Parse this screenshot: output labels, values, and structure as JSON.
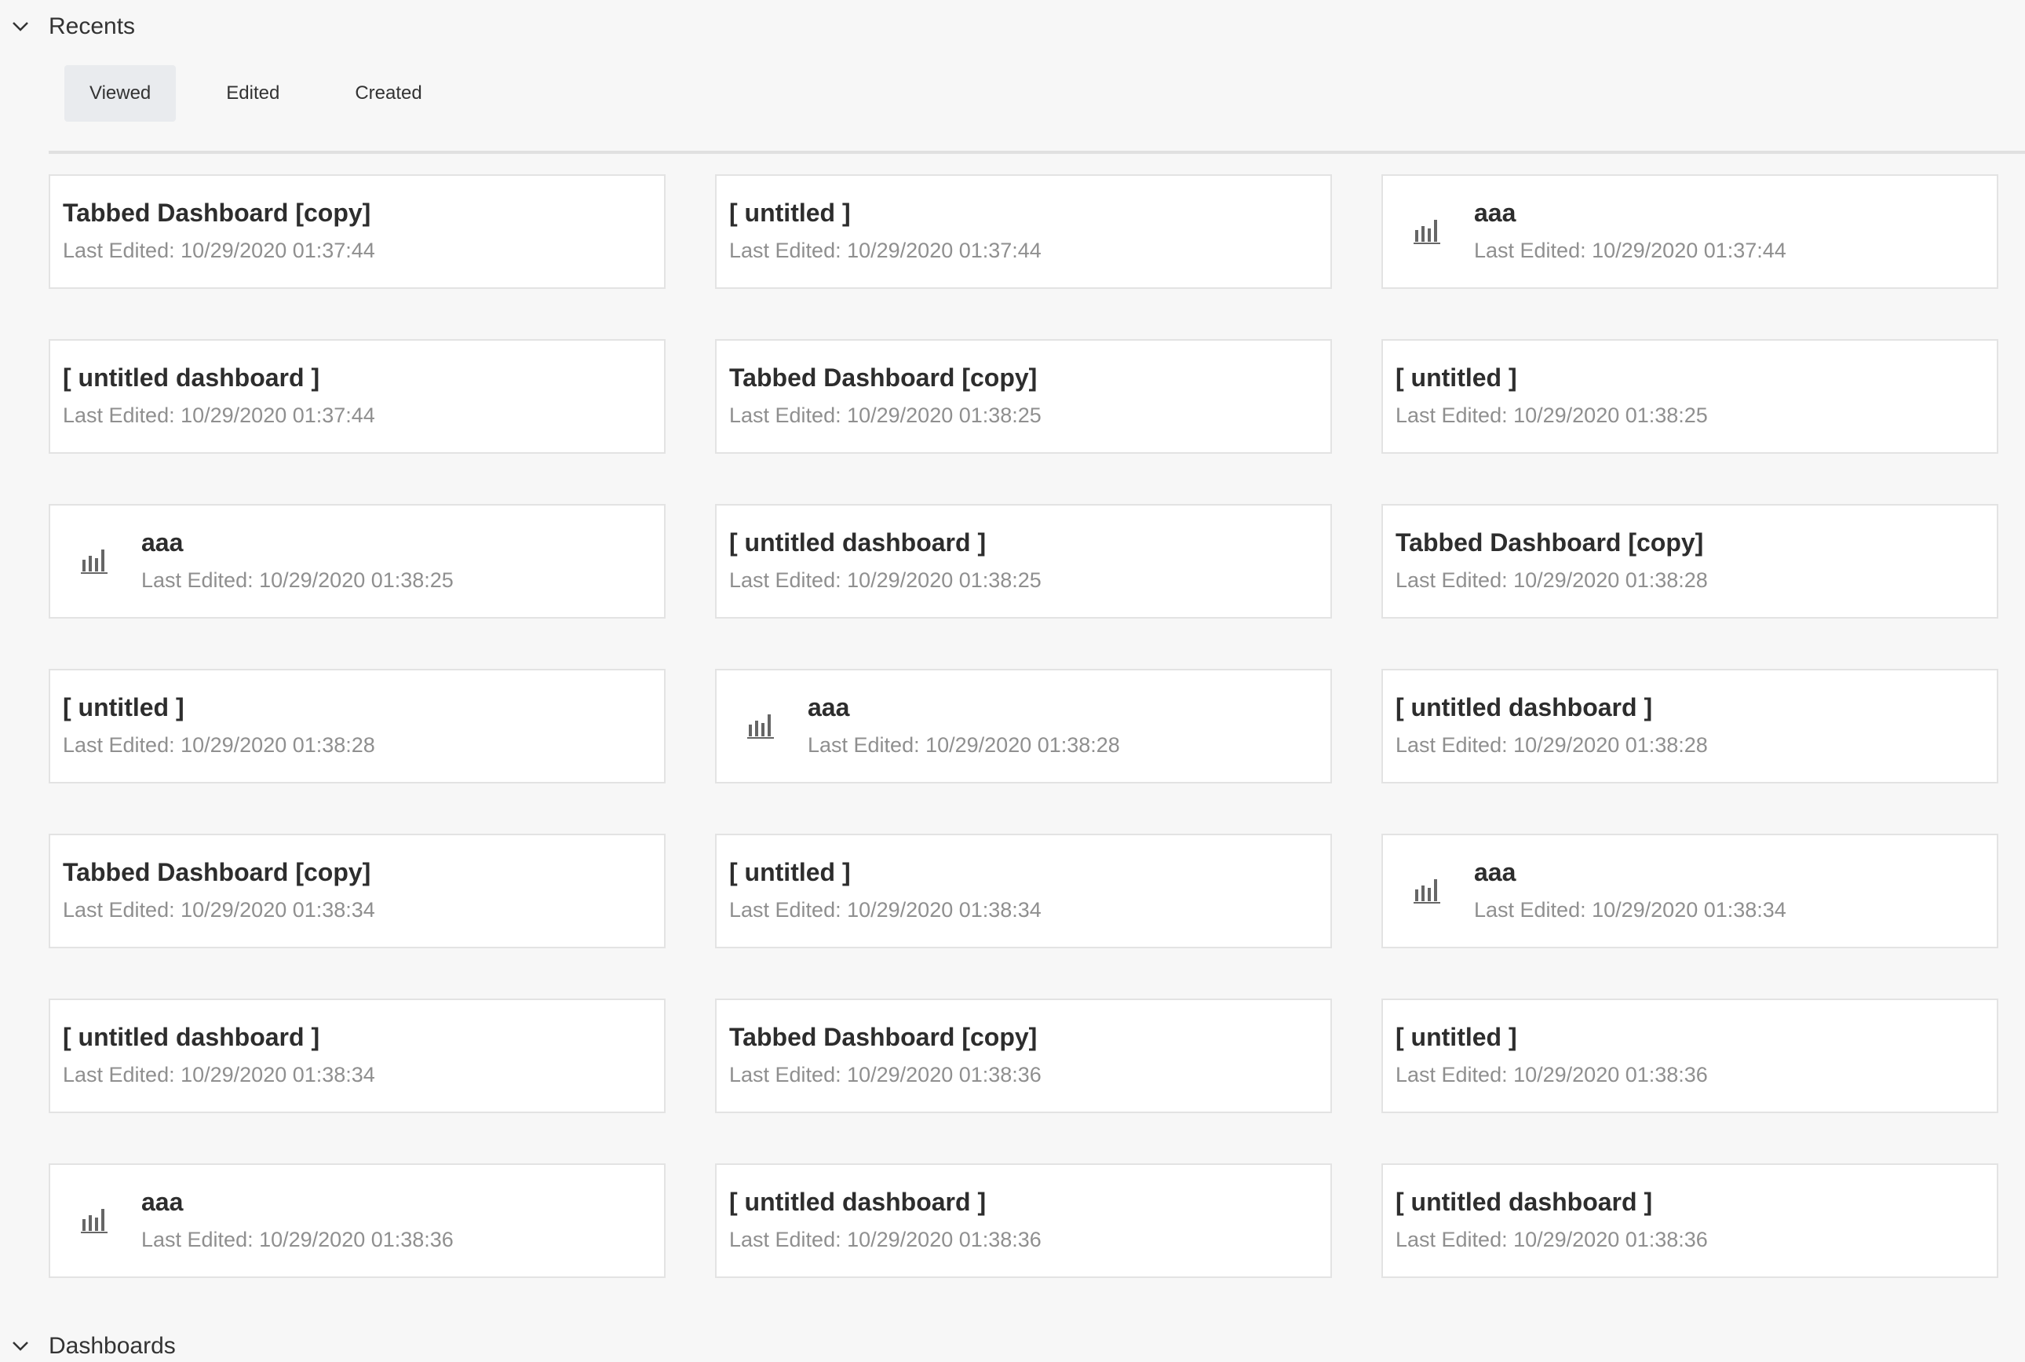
{
  "recents": {
    "title": "Recents",
    "tabs": [
      {
        "label": "Viewed",
        "active": true
      },
      {
        "label": "Edited",
        "active": false
      },
      {
        "label": "Created",
        "active": false
      }
    ],
    "items": [
      {
        "title": "Tabbed Dashboard [copy]",
        "subtitle": "Last Edited: 10/29/2020 01:37:44",
        "icon": null
      },
      {
        "title": "[ untitled ]",
        "subtitle": "Last Edited: 10/29/2020 01:37:44",
        "icon": null
      },
      {
        "title": "aaa",
        "subtitle": "Last Edited: 10/29/2020 01:37:44",
        "icon": "bar-chart-icon"
      },
      {
        "title": "[ untitled dashboard ]",
        "subtitle": "Last Edited: 10/29/2020 01:37:44",
        "icon": null
      },
      {
        "title": "Tabbed Dashboard [copy]",
        "subtitle": "Last Edited: 10/29/2020 01:38:25",
        "icon": null
      },
      {
        "title": "[ untitled ]",
        "subtitle": "Last Edited: 10/29/2020 01:38:25",
        "icon": null
      },
      {
        "title": "aaa",
        "subtitle": "Last Edited: 10/29/2020 01:38:25",
        "icon": "bar-chart-icon"
      },
      {
        "title": "[ untitled dashboard ]",
        "subtitle": "Last Edited: 10/29/2020 01:38:25",
        "icon": null
      },
      {
        "title": "Tabbed Dashboard [copy]",
        "subtitle": "Last Edited: 10/29/2020 01:38:28",
        "icon": null
      },
      {
        "title": "[ untitled ]",
        "subtitle": "Last Edited: 10/29/2020 01:38:28",
        "icon": null
      },
      {
        "title": "aaa",
        "subtitle": "Last Edited: 10/29/2020 01:38:28",
        "icon": "bar-chart-icon"
      },
      {
        "title": "[ untitled dashboard ]",
        "subtitle": "Last Edited: 10/29/2020 01:38:28",
        "icon": null
      },
      {
        "title": "Tabbed Dashboard [copy]",
        "subtitle": "Last Edited: 10/29/2020 01:38:34",
        "icon": null
      },
      {
        "title": "[ untitled ]",
        "subtitle": "Last Edited: 10/29/2020 01:38:34",
        "icon": null
      },
      {
        "title": "aaa",
        "subtitle": "Last Edited: 10/29/2020 01:38:34",
        "icon": "bar-chart-icon"
      },
      {
        "title": "[ untitled dashboard ]",
        "subtitle": "Last Edited: 10/29/2020 01:38:34",
        "icon": null
      },
      {
        "title": "Tabbed Dashboard [copy]",
        "subtitle": "Last Edited: 10/29/2020 01:38:36",
        "icon": null
      },
      {
        "title": "[ untitled ]",
        "subtitle": "Last Edited: 10/29/2020 01:38:36",
        "icon": null
      },
      {
        "title": "aaa",
        "subtitle": "Last Edited: 10/29/2020 01:38:36",
        "icon": "bar-chart-icon"
      },
      {
        "title": "[ untitled dashboard ]",
        "subtitle": "Last Edited: 10/29/2020 01:38:36",
        "icon": null
      },
      {
        "title": "[ untitled dashboard ]",
        "subtitle": "Last Edited: 10/29/2020 01:38:36",
        "icon": null
      }
    ]
  },
  "dashboards": {
    "title": "Dashboards"
  },
  "colors": {
    "background": "#f7f7f7",
    "card_border": "#e3e3e3",
    "active_tab": "#e9ebee",
    "subtitle": "#8f8f8f",
    "icon": "#666666"
  }
}
